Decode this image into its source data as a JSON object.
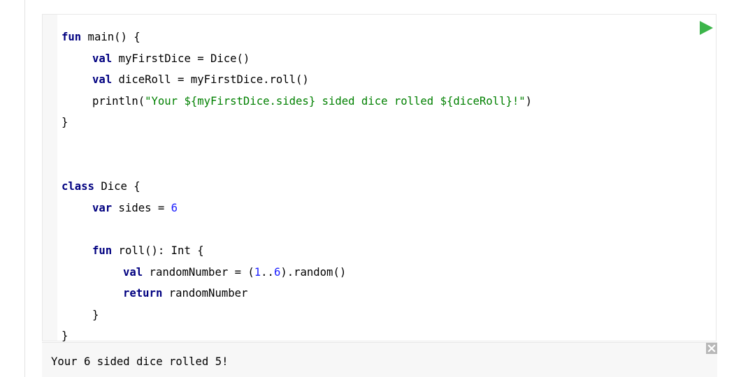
{
  "editor": {
    "run_icon": "run-triangle-icon",
    "run_color": "#3cb54a",
    "lines": [
      {
        "tokens": [
          {
            "t": "kw",
            "v": "fun"
          },
          {
            "t": "plain",
            "v": " main() {"
          }
        ]
      },
      {
        "tokens": [
          {
            "t": "kw",
            "v": "val"
          },
          {
            "t": "plain",
            "v": " myFirstDice = Dice()"
          }
        ]
      },
      {
        "tokens": [
          {
            "t": "kw",
            "v": "val"
          },
          {
            "t": "plain",
            "v": " diceRoll = myFirstDice.roll()"
          }
        ]
      },
      {
        "tokens": [
          {
            "t": "plain",
            "v": "println("
          },
          {
            "t": "str",
            "v": "\"Your ${myFirstDice.sides} sided dice rolled ${diceRoll}!\""
          },
          {
            "t": "plain",
            "v": ")"
          }
        ]
      },
      {
        "tokens": [
          {
            "t": "plain",
            "v": "}"
          }
        ]
      },
      {
        "tokens": []
      },
      {
        "tokens": []
      },
      {
        "tokens": [
          {
            "t": "kw",
            "v": "class"
          },
          {
            "t": "plain",
            "v": " Dice {"
          }
        ]
      },
      {
        "tokens": [
          {
            "t": "kw",
            "v": "var"
          },
          {
            "t": "plain",
            "v": " sides = "
          },
          {
            "t": "num",
            "v": "6"
          }
        ]
      },
      {
        "tokens": []
      },
      {
        "tokens": [
          {
            "t": "kw",
            "v": "fun"
          },
          {
            "t": "plain",
            "v": " roll(): Int {"
          }
        ]
      },
      {
        "tokens": [
          {
            "t": "kw",
            "v": "val"
          },
          {
            "t": "plain",
            "v": " randomNumber = ("
          },
          {
            "t": "num",
            "v": "1"
          },
          {
            "t": "plain",
            "v": ".."
          },
          {
            "t": "num",
            "v": "6"
          },
          {
            "t": "plain",
            "v": ").random()"
          }
        ]
      },
      {
        "tokens": [
          {
            "t": "kw",
            "v": "return"
          },
          {
            "t": "plain",
            "v": " randomNumber"
          }
        ]
      },
      {
        "tokens": [
          {
            "t": "plain",
            "v": "}"
          }
        ]
      },
      {
        "tokens": [
          {
            "t": "plain",
            "v": "}"
          }
        ]
      }
    ]
  },
  "output": {
    "text": "Your 6 sided dice rolled 5!",
    "close_icon": "close-x-icon"
  },
  "colors": {
    "keyword": "#000080",
    "string": "#008000",
    "number": "#1f22ff",
    "gutter": "#f7f7f7",
    "output_background": "#f7f7f7"
  }
}
